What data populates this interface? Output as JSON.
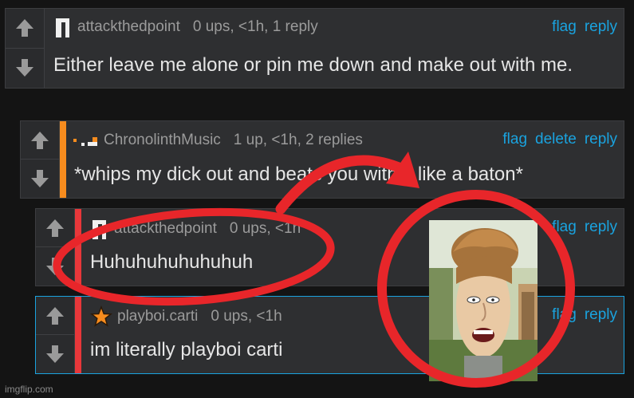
{
  "comments": [
    {
      "username": "attackthedpoint",
      "meta": "0 ups, <1h, 1 reply",
      "text": "Either leave me alone or pin me down and make out with me.",
      "actions": [
        "flag",
        "reply"
      ]
    },
    {
      "username": "ChronolinthMusic",
      "meta": "1 up, <1h, 2 replies",
      "text": "*whips my dick out and beats you with it like a baton*",
      "actions": [
        "flag",
        "delete",
        "reply"
      ]
    },
    {
      "username": "attackthedpoint",
      "meta": "0 ups, <1h",
      "text": "Huhuhuhuhuhuhuh",
      "actions": [
        "flag",
        "reply"
      ]
    },
    {
      "username": "playboi.carti",
      "meta": "0 ups, <1h",
      "text": "im literally playboi carti",
      "actions": [
        "flag",
        "reply"
      ]
    }
  ],
  "colors": {
    "orange_bar": "#f78c1e",
    "red_bar": "#e8373a",
    "link_blue": "#1aa3df",
    "circle_red": "#e8262a"
  },
  "icons": {
    "upvote": "arrow-up-icon",
    "downvote": "arrow-down-icon",
    "star": "star-icon"
  },
  "watermark": "imgflip.com"
}
